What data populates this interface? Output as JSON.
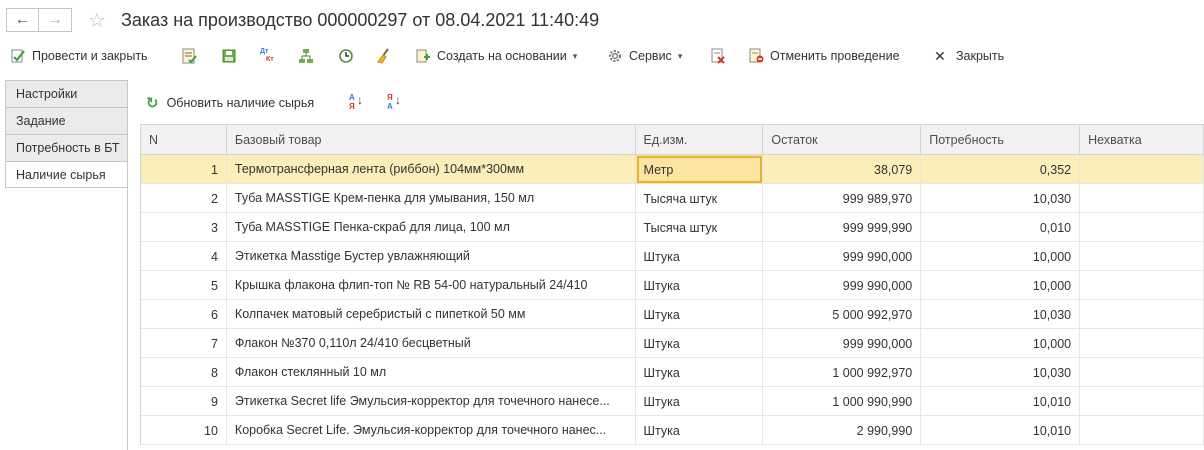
{
  "window": {
    "back_symbol": "←",
    "forward_symbol": "→",
    "favorite_symbol": "☆",
    "title": "Заказ на производство 000000297 от 08.04.2021 11:40:49"
  },
  "toolbar": {
    "post_and_close": "Провести и закрыть",
    "create_based_on": "Создать на основании",
    "service": "Сервис",
    "cancel_posting": "Отменить проведение",
    "close": "Закрыть",
    "close_symbol": "✕",
    "dropdown_symbol": "▾",
    "dtkt_top": "Дт",
    "dtkt_bottom": "Кт"
  },
  "tabs": [
    {
      "label": "Настройки",
      "active": false
    },
    {
      "label": "Задание",
      "active": false
    },
    {
      "label": "Потребность в БТ",
      "active": false
    },
    {
      "label": "Наличие сырья",
      "active": true
    }
  ],
  "subtoolbar": {
    "refresh_symbol": "↻",
    "refresh_label": "Обновить наличие сырья",
    "sort_asc_top": "А",
    "sort_asc_bottom": "Я",
    "sort_desc_top": "Я",
    "sort_desc_bottom": "А",
    "sort_arrow": "↓"
  },
  "table": {
    "columns": [
      "N",
      "Базовый товар",
      "Ед.изм.",
      "Остаток",
      "Потребность",
      "Нехватка"
    ],
    "rows": [
      {
        "n": "1",
        "product": "Термотрансферная лента  (риббон) 104мм*300мм",
        "unit": "Метр",
        "stock": "38,079",
        "need": "0,352",
        "shortage": "",
        "selected": true
      },
      {
        "n": "2",
        "product": "Туба MASSTIGE  Крем-пенка для умывания, 150 мл",
        "unit": "Тысяча штук",
        "stock": "999 989,970",
        "need": "10,030",
        "shortage": ""
      },
      {
        "n": "3",
        "product": "Туба MASSTIGE  Пенка-скраб для лица, 100 мл",
        "unit": "Тысяча штук",
        "stock": "999 999,990",
        "need": "0,010",
        "shortage": ""
      },
      {
        "n": "4",
        "product": "Этикетка Masstige Бустер увлажняющий",
        "unit": "Штука",
        "stock": "999 990,000",
        "need": "10,000",
        "shortage": ""
      },
      {
        "n": "5",
        "product": "Крышка флакона флип-топ № RB 54-00 натуральный 24/410",
        "unit": "Штука",
        "stock": "999 990,000",
        "need": "10,000",
        "shortage": ""
      },
      {
        "n": "6",
        "product": "Колпачек  матовый серебристый с пипеткой 50 мм",
        "unit": "Штука",
        "stock": "5 000 992,970",
        "need": "10,030",
        "shortage": ""
      },
      {
        "n": "7",
        "product": "Флакон №370 0,110л 24/410 бесцветный",
        "unit": "Штука",
        "stock": "999 990,000",
        "need": "10,000",
        "shortage": ""
      },
      {
        "n": "8",
        "product": "Флакон стеклянный 10 мл",
        "unit": "Штука",
        "stock": "1 000 992,970",
        "need": "10,030",
        "shortage": ""
      },
      {
        "n": "9",
        "product": "Этикетка Secret life Эмульсия-корректор для точечного нанесе...",
        "unit": "Штука",
        "stock": "1 000 990,990",
        "need": "10,010",
        "shortage": ""
      },
      {
        "n": "10",
        "product": "Коробка Secret Life. Эмульсия-корректор для точечного нанес...",
        "unit": "Штука",
        "stock": "2 990,990",
        "need": "10,010",
        "shortage": ""
      }
    ]
  },
  "colors": {
    "selected_row": "#fbeeb8",
    "selected_cell_border": "#e3b431",
    "refresh_icon": "#3aa341"
  }
}
